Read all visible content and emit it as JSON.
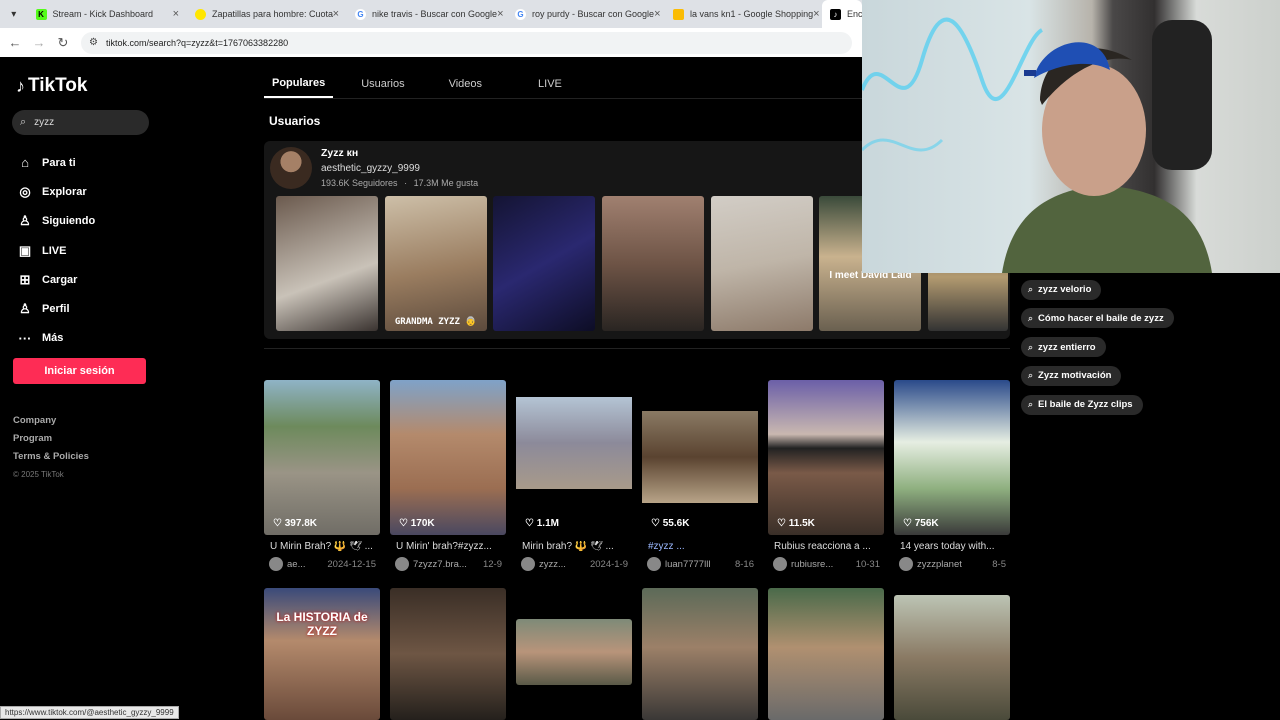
{
  "browser": {
    "tabs": [
      {
        "title": "Stream - Kick Dashboard",
        "icon": "kick-icon",
        "active": false
      },
      {
        "title": "Zapatillas para hombre: Cuotas",
        "icon": "ml-icon",
        "active": false
      },
      {
        "title": "nike travis - Buscar con Google",
        "icon": "google-icon",
        "active": false
      },
      {
        "title": "roy purdy - Buscar con Google",
        "icon": "google-icon",
        "active": false
      },
      {
        "title": "la vans kn1 - Google Shopping",
        "icon": "google-shopping-icon",
        "active": false
      },
      {
        "title": "Encue",
        "icon": "tiktok-icon",
        "active": true
      }
    ],
    "url": "tiktok.com/search?q=zyzz&t=1767063382280"
  },
  "sidebar": {
    "logo": "TikTok",
    "search_value": "zyzz",
    "nav": [
      {
        "label": "Para ti",
        "icon": "home-icon"
      },
      {
        "label": "Explorar",
        "icon": "compass-icon"
      },
      {
        "label": "Siguiendo",
        "icon": "following-icon"
      },
      {
        "label": "LIVE",
        "icon": "live-icon"
      },
      {
        "label": "Cargar",
        "icon": "upload-icon"
      },
      {
        "label": "Perfil",
        "icon": "profile-icon"
      },
      {
        "label": "Más",
        "icon": "more-icon"
      }
    ],
    "login_label": "Iniciar sesión",
    "footer": [
      "Company",
      "Program",
      "Terms & Policies"
    ],
    "copyright": "© 2025 TikTok"
  },
  "search_tabs": [
    "Populares",
    "Usuarios",
    "Videos",
    "LIVE"
  ],
  "users_section": {
    "title": "Usuarios",
    "user": {
      "name": "Zyzz кн",
      "handle": "aesthetic_gyzzy_9999",
      "followers": "193.6K Seguidores",
      "likes": "17.3M Me gusta"
    },
    "thumb_captions": [
      "",
      "GRANDMA ZYZZ 👵",
      "",
      "",
      "",
      "I meet David Laid",
      ""
    ]
  },
  "videos": [
    {
      "likes": "397.8K",
      "title": "U Mirin Brah? 🔱 🕊 ...",
      "author": "ae...",
      "date": "2024-12-15"
    },
    {
      "likes": "170K",
      "title": "U Mirin' brah?#zyzz...",
      "author": "7zyzz7.bra...",
      "date": "12-9"
    },
    {
      "likes": "1.1M",
      "title": "Mirin brah? 🔱 🕊 ...",
      "author": "zyzz...",
      "date": "2024-1-9"
    },
    {
      "likes": "55.6K",
      "title": "#zyzz ...",
      "author": "luan7777lll",
      "date": "8-16"
    },
    {
      "likes": "11.5K",
      "title": "Rubius reacciona a ...",
      "author": "rubiusre...",
      "date": "10-31"
    },
    {
      "likes": "756K",
      "title": "14 years today with...",
      "author": "zyzzplanet",
      "date": "8-5"
    }
  ],
  "second_row_overlay": "La HISTORIA de ZYZZ",
  "related_searches": [
    "zyzz velorio",
    "Cómo hacer el baile de zyzz",
    "zyzz entierro",
    "Zyzz motivación",
    "El baile de Zyzz clips"
  ],
  "status_url": "https://www.tiktok.com/@aesthetic_gyzzy_9999",
  "colors": {
    "accent": "#fe2c55",
    "background": "#000000",
    "card": "#161616"
  }
}
